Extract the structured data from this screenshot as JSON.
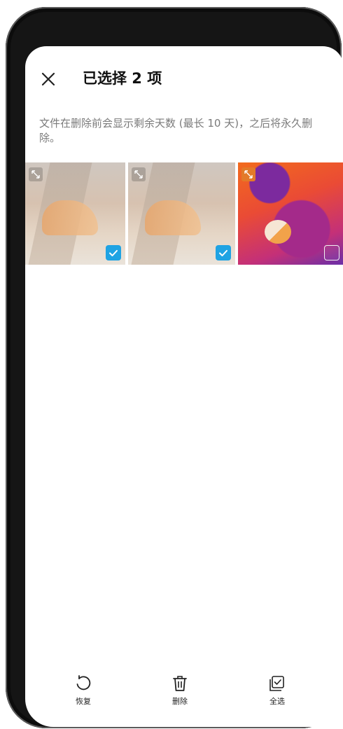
{
  "header": {
    "title": "已选择 2 项",
    "close_icon": "close-icon"
  },
  "notice": {
    "text": "文件在删除前会显示剩余天数 (最长 10 天)，之后将永久删除。"
  },
  "photos": [
    {
      "name": "photo-1",
      "selected": true,
      "expand_icon": "expand-icon"
    },
    {
      "name": "photo-2",
      "selected": true,
      "expand_icon": "expand-icon"
    },
    {
      "name": "photo-3",
      "selected": false,
      "expand_icon": "expand-icon"
    }
  ],
  "toolbar": {
    "restore_label": "恢复",
    "delete_label": "删除",
    "select_all_label": "全选"
  },
  "colors": {
    "accent": "#1fa3e3",
    "expand_orange": "#e37a28",
    "text_secondary": "#7a7a7a"
  }
}
